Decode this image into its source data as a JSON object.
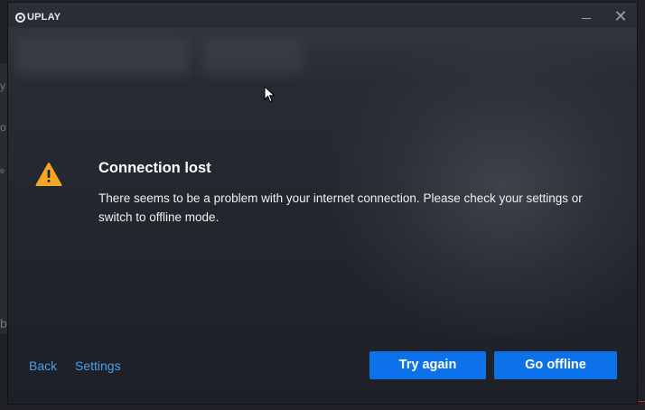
{
  "app": {
    "logo_text": "UPLAY"
  },
  "window_controls": {
    "minimize": "",
    "close": "✕"
  },
  "background_fragments": [
    {
      "text": "y"
    },
    {
      "text": "o"
    },
    {
      "text": "e"
    },
    {
      "text": "b"
    }
  ],
  "dialog": {
    "icon": "warning-triangle-icon",
    "icon_color": "#f5a623",
    "title": "Connection lost",
    "message": "There seems to be a problem with your internet connection. Please check your settings or switch to offline mode."
  },
  "footer": {
    "back_label": "Back",
    "settings_label": "Settings",
    "try_again_label": "Try again",
    "go_offline_label": "Go offline"
  },
  "colors": {
    "accent_button": "#0d72ea",
    "link": "#4a9fe8",
    "warning": "#f5a623"
  }
}
